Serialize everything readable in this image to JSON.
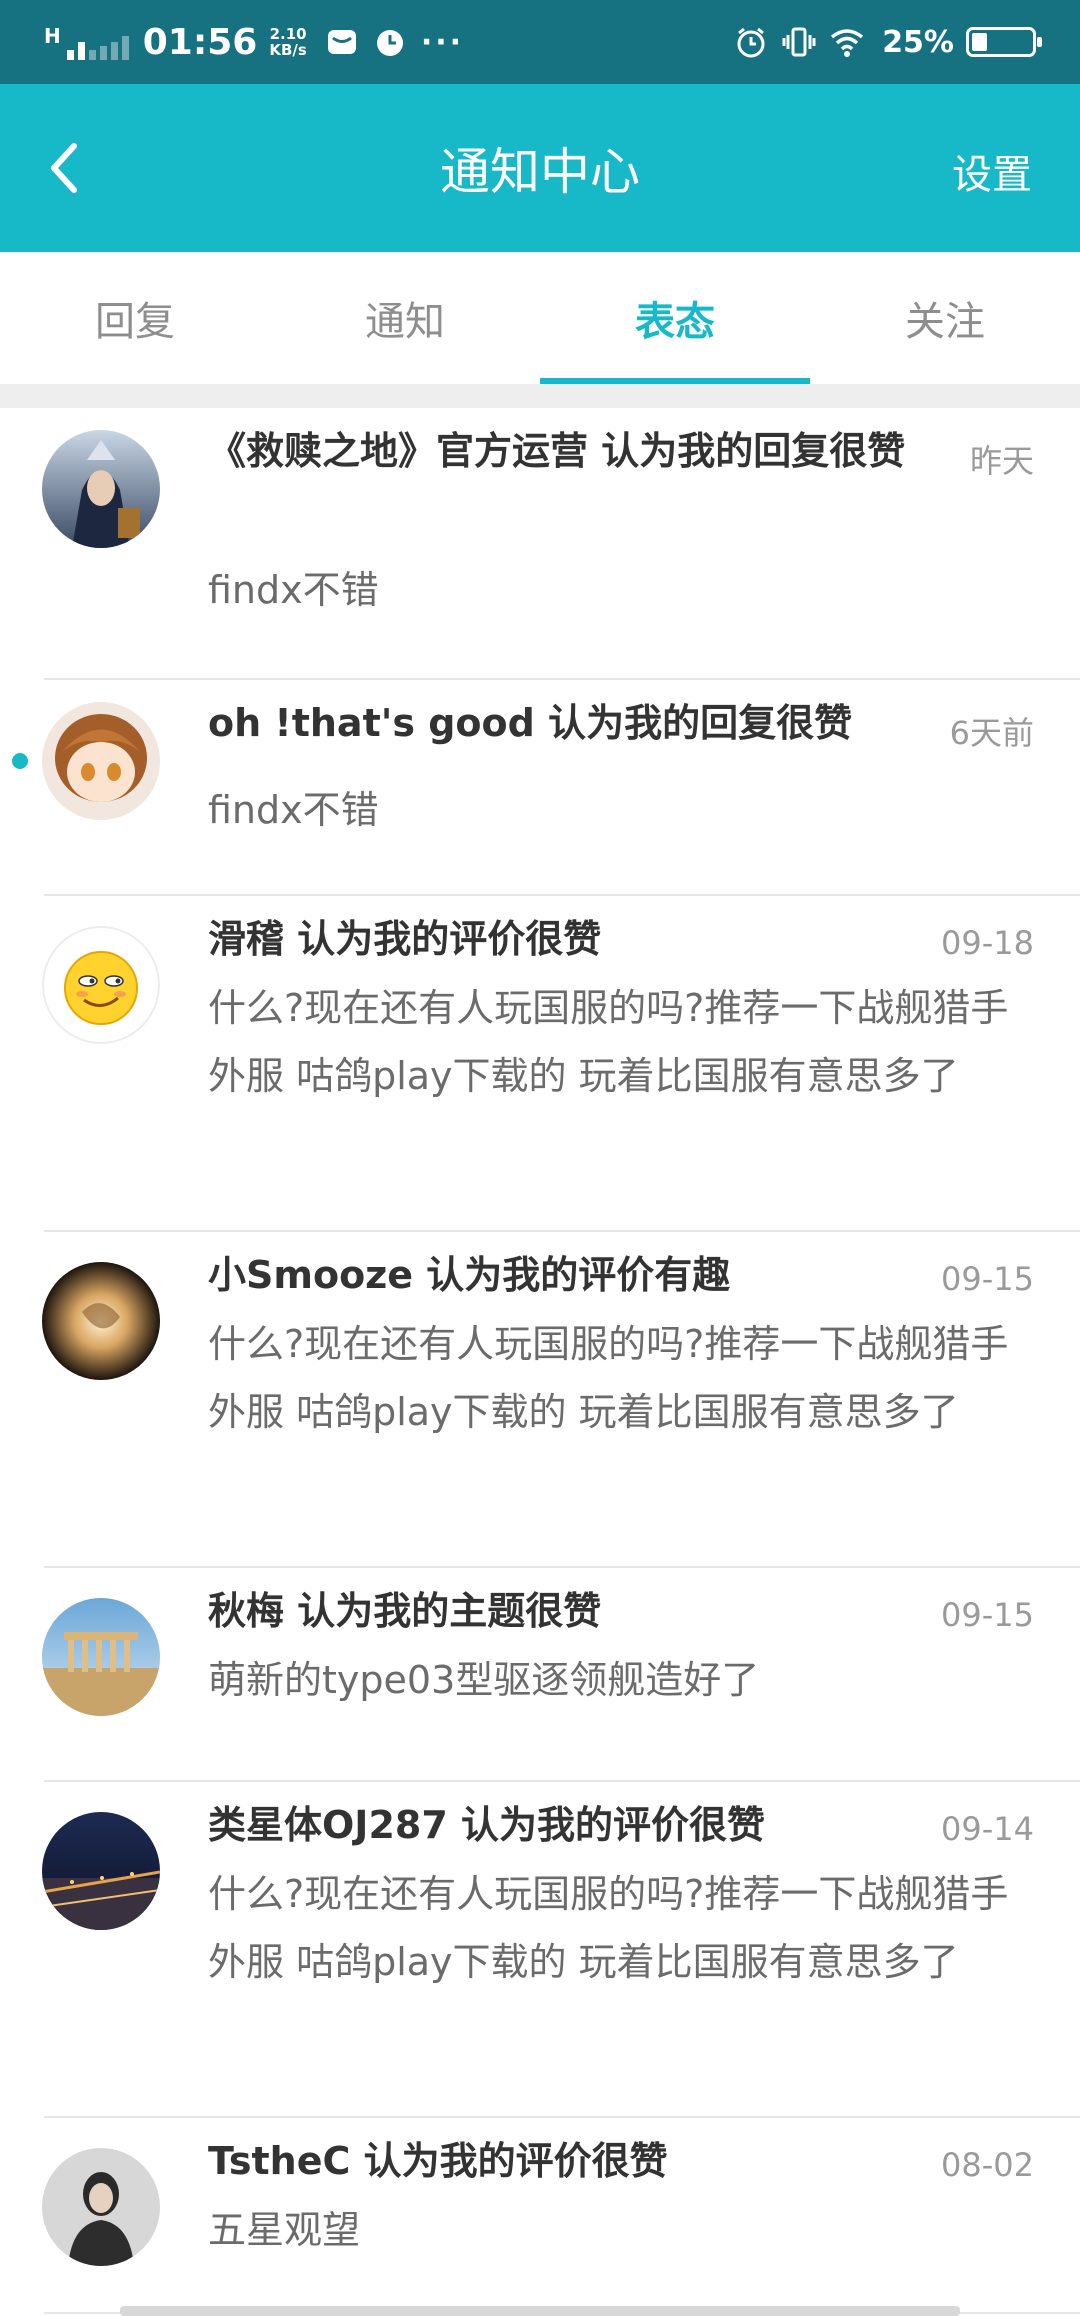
{
  "status_bar": {
    "time": "01:56",
    "speed_value": "2.10",
    "speed_unit": "KB/s",
    "dots": "···",
    "battery_percent": "25%",
    "battery_level": 0.25,
    "network_label": "H"
  },
  "header": {
    "title": "通知中心",
    "settings_label": "设置"
  },
  "tabs": [
    {
      "label": "回复",
      "active": false
    },
    {
      "label": "通知",
      "active": false
    },
    {
      "label": "表态",
      "active": true
    },
    {
      "label": "关注",
      "active": false
    }
  ],
  "items": [
    {
      "title": "《救赎之地》官方运营 认为我的回复很赞",
      "time": "昨天",
      "content": "findx不错",
      "unread": false,
      "avatar_icon": "game-character-avatar"
    },
    {
      "title": "oh !that's good 认为我的回复很赞",
      "time": "6天前",
      "content": "findx不错",
      "unread": true,
      "avatar_icon": "anime-girl-avatar"
    },
    {
      "title": "滑稽 认为我的评价很赞",
      "time": "09-18",
      "content": "什么?现在还有人玩国服的吗?推荐一下战舰猎手外服 咕鸽play下载的 玩着比国服有意思多了",
      "unread": false,
      "avatar_icon": "smirk-emoji-avatar"
    },
    {
      "title": "小Smooze 认为我的评价有趣",
      "time": "09-15",
      "content": "什么?现在还有人玩国服的吗?推荐一下战舰猎手外服 咕鸽play下载的 玩着比国服有意思多了",
      "unread": false,
      "avatar_icon": "glowing-orb-avatar"
    },
    {
      "title": "秋梅 认为我的主题很赞",
      "time": "09-15",
      "content": "萌新的type03型驱逐领舰造好了",
      "unread": false,
      "avatar_icon": "ruins-photo-avatar"
    },
    {
      "title": "类星体OJ287 认为我的评价很赞",
      "time": "09-14",
      "content": "什么?现在还有人玩国服的吗?推荐一下战舰猎手外服 咕鸽play下载的 玩着比国服有意思多了",
      "unread": false,
      "avatar_icon": "night-city-avatar"
    },
    {
      "title": "TstheC 认为我的评价很赞",
      "time": "08-02",
      "content": "五星观望",
      "unread": false,
      "avatar_icon": "person-photo-avatar"
    }
  ],
  "colors": {
    "status_bar": "#167180",
    "accent": "#17b9c9"
  }
}
